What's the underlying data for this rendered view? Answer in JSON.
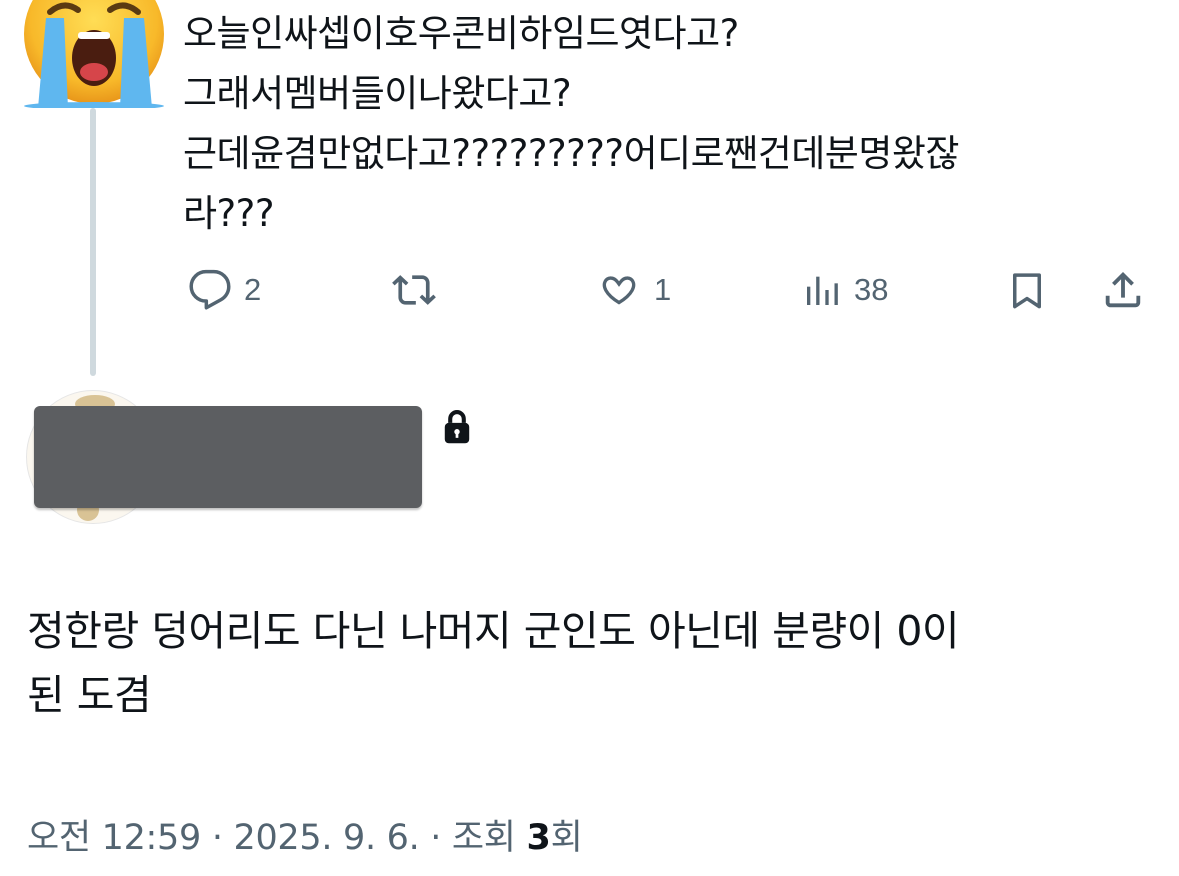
{
  "parent_tweet": {
    "avatar_icon": "loudly-crying-face-icon",
    "text_lines": [
      "오늘인싸셉이호우콘비하임드엿다고?",
      "그래서멤버들이나왔다고?",
      "근데윤겸만없다고?????????어디로짼건데분명왔잖",
      "라???"
    ],
    "actions": {
      "reply_count": "2",
      "retweet_count": "",
      "like_count": "1",
      "views_count": "38"
    }
  },
  "reply_tweet": {
    "author_hidden": true,
    "protected_account_icon": "lock-icon",
    "text_lines": [
      "정한랑 덩어리도 다닌 나머지 군인도 아닌데 분량이 0이",
      "된 도겸"
    ],
    "meta": {
      "time": "오전 12:59",
      "separator": "·",
      "date": "2025. 9. 6.",
      "views_label": "조회",
      "views_count": "3",
      "views_unit": "회"
    }
  },
  "colors": {
    "text_primary": "#0f1419",
    "text_secondary": "#536471",
    "thread_line": "#cfd9de",
    "censor_box": "#5c5e61"
  }
}
